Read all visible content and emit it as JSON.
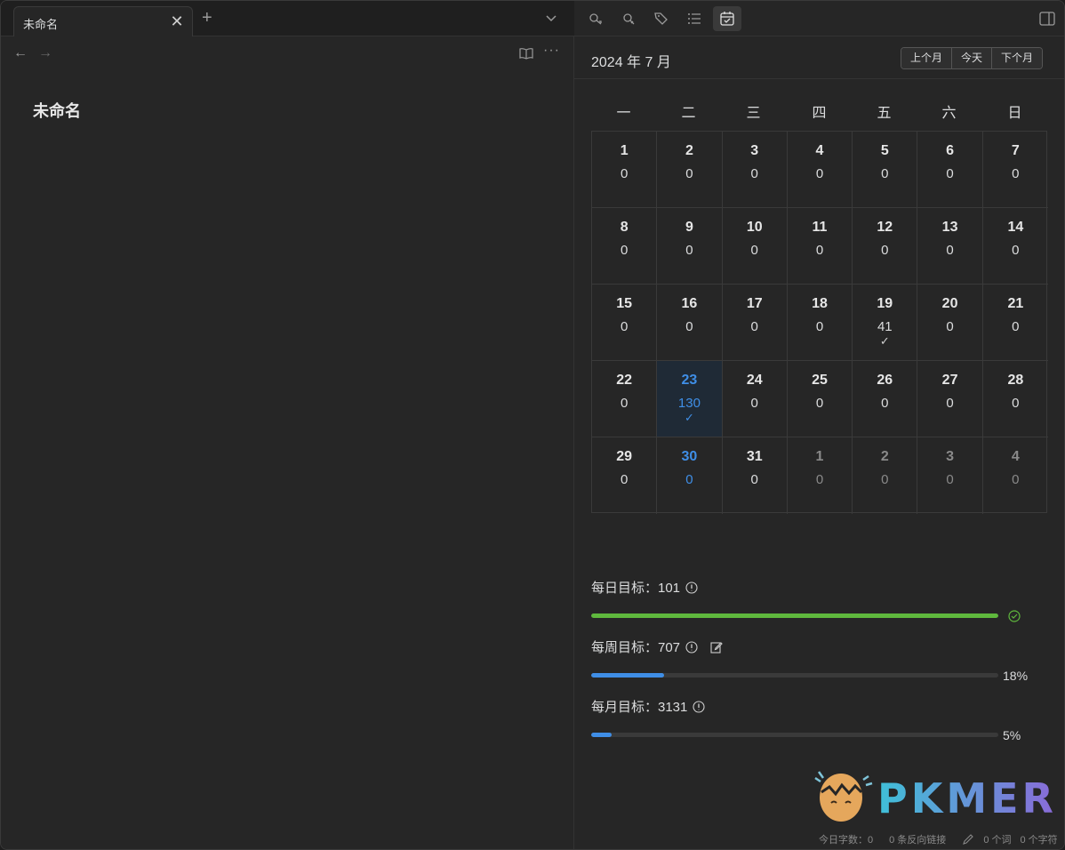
{
  "tab": {
    "title": "未命名"
  },
  "note": {
    "title": "未命名"
  },
  "calendar": {
    "month_label": "2024 年 7 月",
    "buttons": {
      "prev": "上个月",
      "today": "今天",
      "next": "下个月"
    },
    "weekdays": [
      "一",
      "二",
      "三",
      "四",
      "五",
      "六",
      "日"
    ],
    "days": [
      {
        "day": "1",
        "count": "0"
      },
      {
        "day": "2",
        "count": "0"
      },
      {
        "day": "3",
        "count": "0"
      },
      {
        "day": "4",
        "count": "0"
      },
      {
        "day": "5",
        "count": "0"
      },
      {
        "day": "6",
        "count": "0"
      },
      {
        "day": "7",
        "count": "0"
      },
      {
        "day": "8",
        "count": "0"
      },
      {
        "day": "9",
        "count": "0"
      },
      {
        "day": "10",
        "count": "0"
      },
      {
        "day": "11",
        "count": "0"
      },
      {
        "day": "12",
        "count": "0"
      },
      {
        "day": "13",
        "count": "0"
      },
      {
        "day": "14",
        "count": "0"
      },
      {
        "day": "15",
        "count": "0"
      },
      {
        "day": "16",
        "count": "0"
      },
      {
        "day": "17",
        "count": "0"
      },
      {
        "day": "18",
        "count": "0"
      },
      {
        "day": "19",
        "count": "41",
        "check": true
      },
      {
        "day": "20",
        "count": "0"
      },
      {
        "day": "21",
        "count": "0"
      },
      {
        "day": "22",
        "count": "0"
      },
      {
        "day": "23",
        "count": "130",
        "check": true,
        "today": true
      },
      {
        "day": "24",
        "count": "0"
      },
      {
        "day": "25",
        "count": "0"
      },
      {
        "day": "26",
        "count": "0"
      },
      {
        "day": "27",
        "count": "0"
      },
      {
        "day": "28",
        "count": "0"
      },
      {
        "day": "29",
        "count": "0"
      },
      {
        "day": "30",
        "count": "0",
        "highlight": true
      },
      {
        "day": "31",
        "count": "0"
      },
      {
        "day": "1",
        "count": "0",
        "other": true
      },
      {
        "day": "2",
        "count": "0",
        "other": true
      },
      {
        "day": "3",
        "count": "0",
        "other": true
      },
      {
        "day": "4",
        "count": "0",
        "other": true
      }
    ]
  },
  "goals": {
    "daily": {
      "label": "每日目标：101",
      "progress": 1.0,
      "color": "#5fb83d"
    },
    "weekly": {
      "label": "每周目标：707",
      "progress": 0.18,
      "percent_text": "18%",
      "color": "#3f8ee6"
    },
    "monthly": {
      "label": "每月目标：3131",
      "progress": 0.05,
      "percent_text": "5%",
      "color": "#3f8ee6"
    }
  },
  "logo": {
    "text": "PKMER"
  },
  "status": {
    "today_words": "今日字数：0",
    "backlinks": "0 条反向链接",
    "words": "0 个词",
    "chars": "0 个字符"
  },
  "colors": {
    "accent": "#3f8ee6",
    "success": "#5fb83d"
  }
}
